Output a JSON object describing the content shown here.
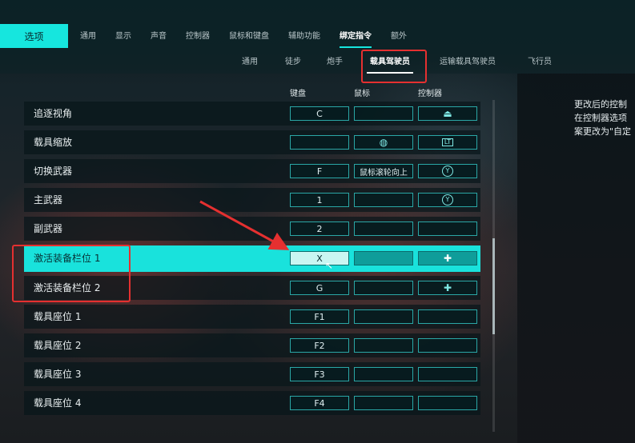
{
  "header": {
    "options_label": "选项",
    "main_tabs": [
      "通用",
      "显示",
      "声音",
      "控制器",
      "鼠标和键盘",
      "辅助功能",
      "绑定指令",
      "额外"
    ],
    "sub_tabs": [
      "通用",
      "徒步",
      "炮手",
      "载具驾驶员",
      "运输载具驾驶员",
      "飞行员"
    ]
  },
  "columns": {
    "keyboard": "键盘",
    "mouse": "鼠标",
    "controller": "控制器"
  },
  "rows": [
    {
      "label": "追逐视角",
      "keyboard": "C",
      "mouse": "",
      "controller_icon": "right-stick-press-icon",
      "controller_glyph": "⏏"
    },
    {
      "label": "载具缩放",
      "keyboard": "",
      "mouse_icon": "mouse-icon",
      "mouse_glyph": "◍",
      "controller_icon": "lt-trigger-icon",
      "controller_glyph": "LT"
    },
    {
      "label": "切换武器",
      "keyboard": "F",
      "mouse": "鼠标滚轮向上",
      "controller_icon": "y-button-icon",
      "controller_glyph": "Y"
    },
    {
      "label": "主武器",
      "keyboard": "1",
      "mouse": "",
      "controller_icon": "y-button-icon",
      "controller_glyph": "Y"
    },
    {
      "label": "副武器",
      "keyboard": "2",
      "mouse": "",
      "controller": ""
    },
    {
      "label": "激活装备栏位 1",
      "keyboard": "X",
      "mouse": "",
      "controller_icon": "dpad-icon",
      "controller_glyph": "✚"
    },
    {
      "label": "激活装备栏位 2",
      "keyboard": "G",
      "mouse": "",
      "controller_icon": "dpad-icon",
      "controller_glyph": "✚"
    },
    {
      "label": "载具座位 1",
      "keyboard": "F1",
      "mouse": "",
      "controller": ""
    },
    {
      "label": "载具座位 2",
      "keyboard": "F2",
      "mouse": "",
      "controller": ""
    },
    {
      "label": "载具座位 3",
      "keyboard": "F3",
      "mouse": "",
      "controller": ""
    },
    {
      "label": "载具座位 4",
      "keyboard": "F4",
      "mouse": "",
      "controller": ""
    }
  ],
  "help": [
    "更改后的控制",
    "在控制器选项",
    "案更改为\"自定"
  ],
  "colors": {
    "accent": "#16e6de",
    "annotation": "#e53030",
    "panel": "#081a1e"
  }
}
